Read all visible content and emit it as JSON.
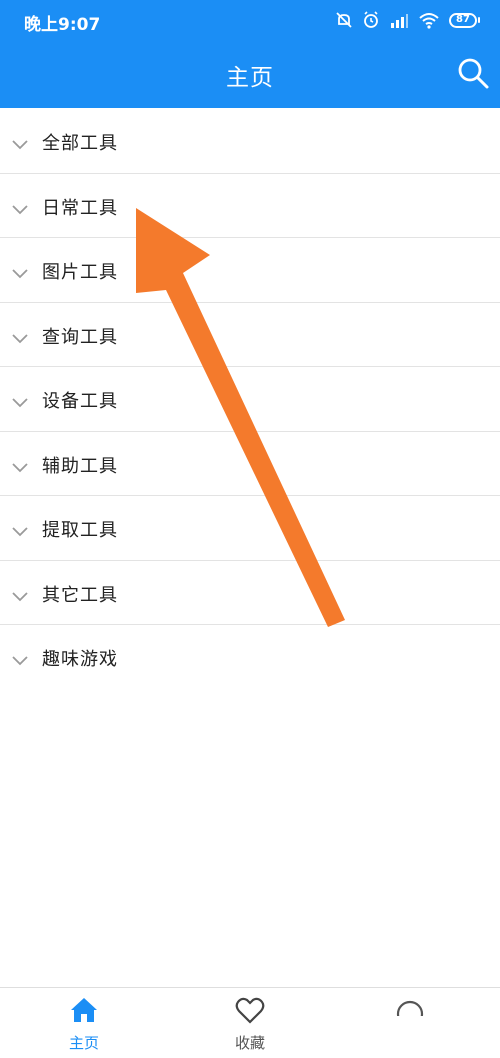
{
  "status_bar": {
    "time": "晚上9:07",
    "battery_level": "87"
  },
  "header": {
    "title": "主页"
  },
  "categories": [
    {
      "label": "全部工具"
    },
    {
      "label": "日常工具"
    },
    {
      "label": "图片工具"
    },
    {
      "label": "查询工具"
    },
    {
      "label": "设备工具"
    },
    {
      "label": "辅助工具"
    },
    {
      "label": "提取工具"
    },
    {
      "label": "其它工具"
    },
    {
      "label": "趣味游戏"
    }
  ],
  "bottom_nav": {
    "home_label": "主页",
    "favorites_label": "收藏"
  },
  "colors": {
    "primary": "#1b8ef5",
    "annotation_arrow": "#f47a2c"
  },
  "icons": {
    "search": "search-icon",
    "chevron": "chevron-down-icon",
    "home": "home-icon",
    "favorites": "heart-icon"
  }
}
